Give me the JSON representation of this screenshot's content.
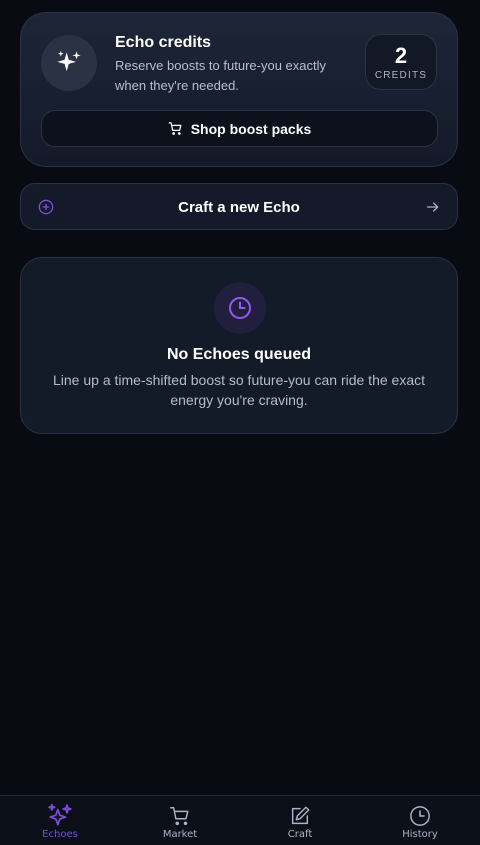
{
  "credits_card": {
    "title": "Echo credits",
    "description": "Reserve boosts to future-you exactly when they're needed.",
    "count": "2",
    "count_unit": "CREDITS",
    "shop_button": "Shop boost packs",
    "icon": "sparkles-icon"
  },
  "craft": {
    "label": "Craft a new Echo",
    "leading_icon": "plus-circle-icon",
    "trailing_icon": "arrow-right-icon"
  },
  "empty_state": {
    "title": "No Echoes queued",
    "description": "Line up a time-shifted boost so future-you can ride the exact energy you're craving.",
    "icon": "clock-icon"
  },
  "bottom_nav": {
    "items": [
      {
        "label": "Echoes",
        "icon": "sparkles-icon",
        "active": true
      },
      {
        "label": "Market",
        "icon": "cart-icon",
        "active": false
      },
      {
        "label": "Craft",
        "icon": "edit-icon",
        "active": false
      },
      {
        "label": "History",
        "icon": "clock-icon",
        "active": false
      }
    ]
  },
  "colors": {
    "background": "#080b12",
    "accent": "#7c4ddb",
    "card": "#141a29",
    "muted_text": "#b3bbd0"
  }
}
